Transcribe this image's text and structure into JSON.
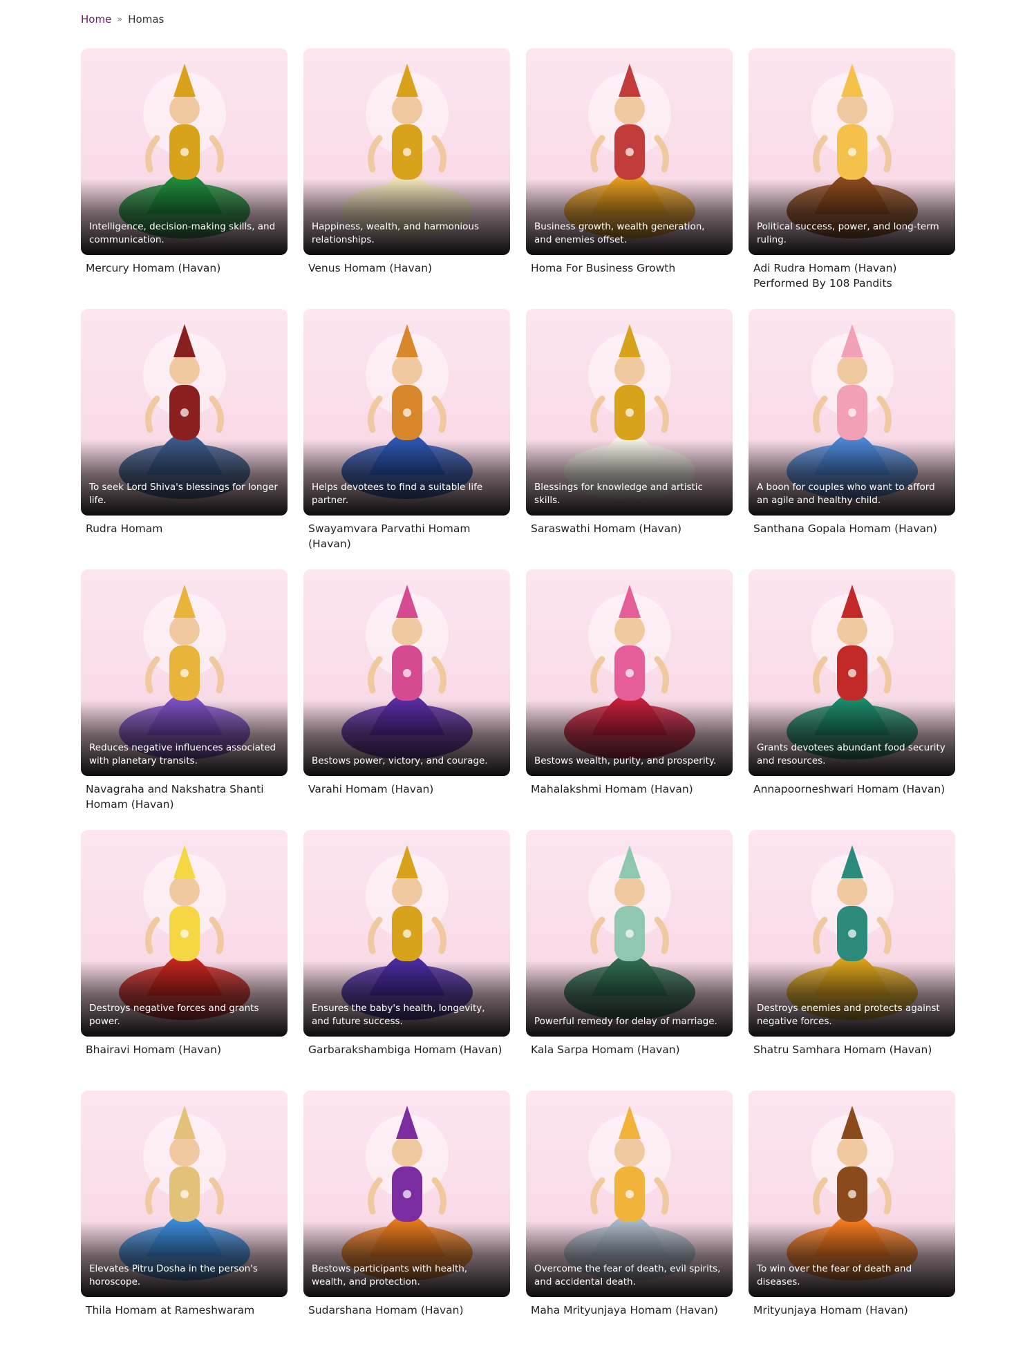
{
  "breadcrumb": {
    "home": "Home",
    "separator": "»",
    "current": "Homas"
  },
  "cards": [
    {
      "caption": "Intelligence, decision-making skills, and communication.",
      "title": "Mercury Homam (Havan)",
      "image": "deity-green",
      "palette": [
        "#1f8a3b",
        "#d9a21b"
      ]
    },
    {
      "caption": "Happiness, wealth, and harmonious relationships.",
      "title": "Venus Homam (Havan)",
      "image": "deity-gold",
      "palette": [
        "#f0e2b8",
        "#d9a21b"
      ]
    },
    {
      "caption": "Business growth, wealth generation, and enemies offset.",
      "title": "Homa For Business Growth",
      "image": "deity-group",
      "palette": [
        "#e39b1f",
        "#c23c3c"
      ]
    },
    {
      "caption": "Political success, power, and long-term ruling.",
      "title": "Adi Rudra Homam (Havan) Performed By 108 Pandits",
      "image": "ritual-gathering",
      "palette": [
        "#8a4a1c",
        "#f4c14b"
      ]
    },
    {
      "caption": "To seek Lord Shiva's blessings for longer life.",
      "title": "Rudra Homam",
      "image": "deity-blue-dancing",
      "palette": [
        "#3c5a8a",
        "#8a1f1f"
      ]
    },
    {
      "caption": "Helps devotees to find a suitable life partner.",
      "title": "Swayamvara Parvathi Homam (Havan)",
      "image": "deity-couple",
      "palette": [
        "#2d55b0",
        "#d8882a"
      ]
    },
    {
      "caption": "Blessings for knowledge and artistic skills.",
      "title": "Saraswathi Homam (Havan)",
      "image": "deity-veena",
      "palette": [
        "#f4f1e6",
        "#d9a21b"
      ]
    },
    {
      "caption": "A boon for couples who want to afford an agile and healthy child.",
      "title": "Santhana Gopala Homam (Havan)",
      "image": "deity-krishna-cow",
      "palette": [
        "#4c86d6",
        "#f1a0b5"
      ]
    },
    {
      "caption": "Reduces negative influences associated with planetary transits.",
      "title": "Navagraha and Nakshatra Shanti Homam (Havan)",
      "image": "zodiac-wheel",
      "palette": [
        "#7c4fc2",
        "#e8b53a"
      ]
    },
    {
      "caption": "Bestows power, victory, and courage.",
      "title": "Varahi Homam (Havan)",
      "image": "deity-purple-lotus",
      "palette": [
        "#5a2ca0",
        "#d64a92"
      ]
    },
    {
      "caption": "Bestows wealth, purity, and prosperity.",
      "title": "Mahalakshmi Homam (Havan)",
      "image": "deity-red-lotus",
      "palette": [
        "#c21f3a",
        "#e55e9a"
      ]
    },
    {
      "caption": "Grants devotees abundant food security and resources.",
      "title": "Annapoorneshwari Homam (Havan)",
      "image": "deity-green-pot",
      "palette": [
        "#1d8a6a",
        "#c22a2a"
      ]
    },
    {
      "caption": "Destroys negative forces and grants power.",
      "title": "Bhairavi Homam (Havan)",
      "image": "deity-red-halo",
      "palette": [
        "#c2261f",
        "#f4d742"
      ]
    },
    {
      "caption": "Ensures the baby's health, longevity, and future success.",
      "title": "Garbarakshambiga Homam (Havan)",
      "image": "deity-standing",
      "palette": [
        "#4a2ca0",
        "#d9a21b"
      ]
    },
    {
      "caption": "Powerful remedy for delay of marriage.",
      "title": "Kala Sarpa Homam (Havan)",
      "image": "deity-serpents",
      "palette": [
        "#2f6b4f",
        "#8fc7b0"
      ]
    },
    {
      "caption": "Destroys enemies and protects against negative forces.",
      "title": "Shatru Samhara Homam (Havan)",
      "image": "deity-peacock",
      "palette": [
        "#d8a21b",
        "#2c8a7a"
      ]
    },
    {
      "caption": "Elevates Pitru Dosha in the person's horoscope.",
      "title": "Thila Homam at Rameshwaram",
      "image": "temple-fire",
      "palette": [
        "#3c8ad6",
        "#e5c27a"
      ]
    },
    {
      "caption": "Bestows participants with health, wealth, and protection.",
      "title": "Sudarshana Homam (Havan)",
      "image": "deity-many-arms",
      "palette": [
        "#e37a1f",
        "#7a2ca0"
      ]
    },
    {
      "caption": "Overcome the fear of death, evil spirits, and accidental death.",
      "title": "Maha Mrityunjaya Homam (Havan)",
      "image": "deity-shiva",
      "palette": [
        "#a9b8c8",
        "#f2b33a"
      ]
    },
    {
      "caption": "To win over the fear of death and diseases.",
      "title": "Mrityunjaya Homam (Havan)",
      "image": "priest-fire",
      "palette": [
        "#f27a1f",
        "#8a4a1c"
      ]
    }
  ]
}
